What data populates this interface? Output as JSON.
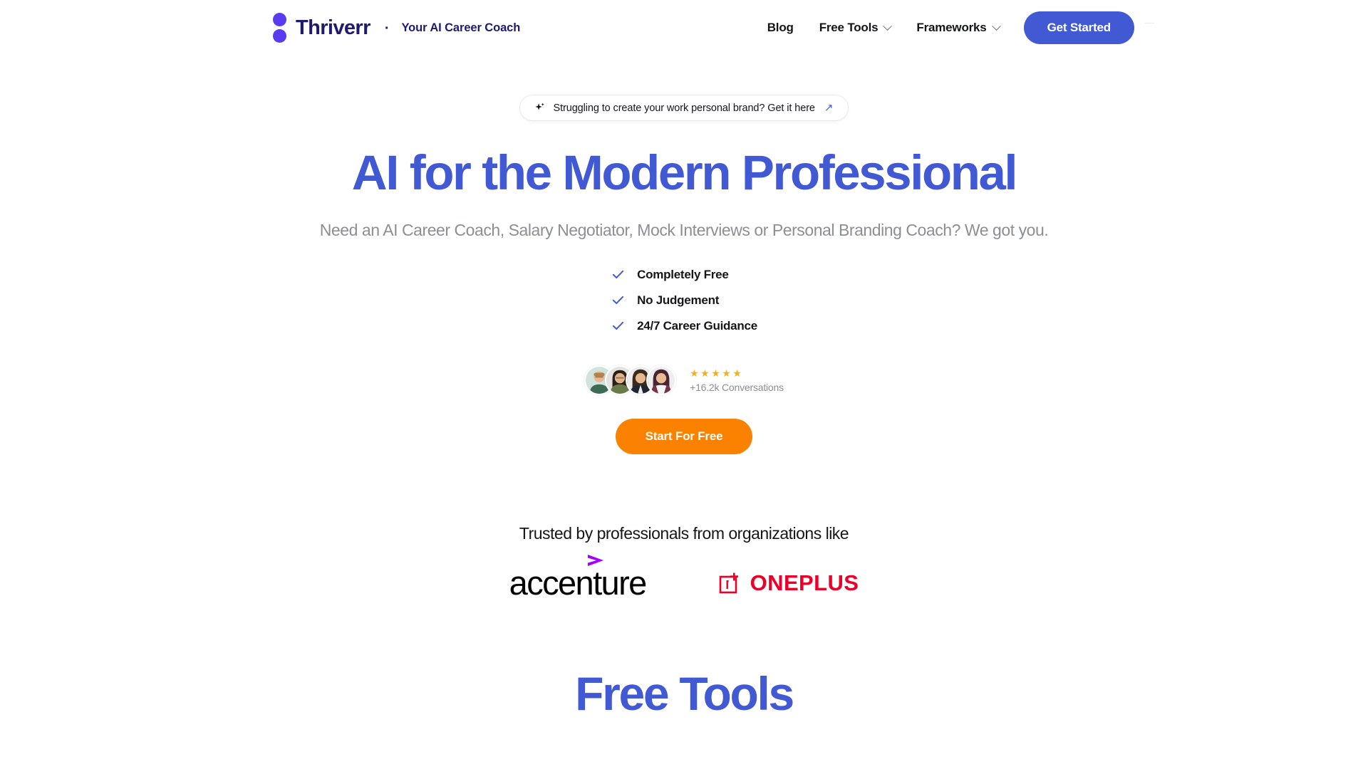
{
  "header": {
    "brand": {
      "name": "Thriverr",
      "separator": "·",
      "tagline": "Your AI Career Coach",
      "logo_color": "#5B3BF0",
      "name_color": "#1E1A6E"
    },
    "nav": [
      {
        "label": "Blog",
        "has_dropdown": false
      },
      {
        "label": "Free Tools",
        "has_dropdown": true
      },
      {
        "label": "Frameworks",
        "has_dropdown": true
      }
    ],
    "cta": {
      "label": "Get Started",
      "color": "#4259D4"
    }
  },
  "hero": {
    "banner": {
      "icon": "sparkle-icon",
      "text": "Struggling to create your work personal brand? Get it here",
      "arrow": "↗",
      "arrow_color": "#4259D4"
    },
    "headline": "AI for the Modern Professional",
    "headline_color": "#4259D4",
    "subhead": "Need an AI Career Coach, Salary Negotiator, Mock Interviews or Personal Branding Coach? We got you.",
    "features": [
      {
        "label": "Completely Free"
      },
      {
        "label": "No Judgement"
      },
      {
        "label": "24/7 Career Guidance"
      }
    ],
    "check_color": "#4259D4",
    "social_proof": {
      "avatar_count": 4,
      "stars": "★★★★★",
      "star_count": 5,
      "star_color": "#F2B01E",
      "conversations": "+16.2k Conversations"
    },
    "cta": {
      "label": "Start For Free",
      "color": "#FB8100"
    }
  },
  "trusted": {
    "title": "Trusted by professionals from organizations like",
    "logos": [
      {
        "name": "accenture",
        "text": "accenture",
        "accent_color": "#A100FF",
        "text_color": "#000000"
      },
      {
        "name": "oneplus",
        "text": "ONEPLUS",
        "mark": "1+",
        "color": "#EB0029"
      }
    ]
  },
  "free_tools_section": {
    "title": "Free Tools",
    "title_color": "#4259D4"
  }
}
